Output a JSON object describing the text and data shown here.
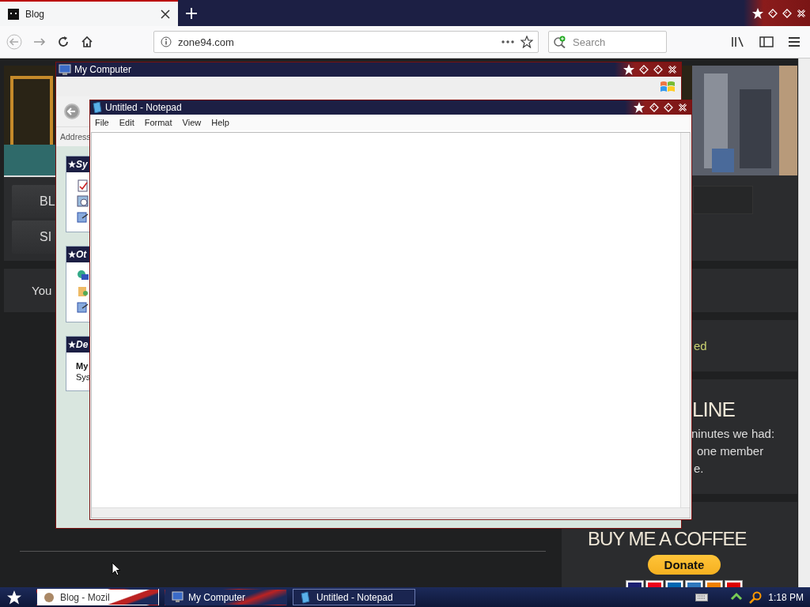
{
  "browser": {
    "tabs": [
      {
        "title": "Blog",
        "selected": true
      }
    ],
    "url": "zone94.com",
    "search": {
      "placeholder": "Search"
    }
  },
  "page": {
    "nav_items": [
      {
        "label": "BL"
      },
      {
        "label": "SI"
      }
    ],
    "notice": "You",
    "status_text": "ed",
    "online": {
      "heading": "LINE",
      "lines": [
        "ninutes we had:",
        "one member",
        "e."
      ]
    },
    "coffee": {
      "heading": "BUY ME A COFFEE",
      "button": "Donate"
    }
  },
  "my_computer": {
    "title": "My Computer",
    "address_label": "Address",
    "task_panels": [
      {
        "kind": "links",
        "title": "Sy"
      },
      {
        "kind": "links",
        "title": "Ot"
      },
      {
        "kind": "details",
        "title": "De",
        "lines": [
          "My",
          "Sys"
        ]
      }
    ]
  },
  "notepad": {
    "title": "Untitled - Notepad",
    "menu": [
      "File",
      "Edit",
      "Format",
      "View",
      "Help"
    ]
  },
  "taskbar": {
    "tasks": [
      {
        "label": "Blog - Mozil",
        "kind": "flag",
        "selected": false
      },
      {
        "label": "My Computer",
        "kind": "stripe",
        "selected": false
      },
      {
        "label": "Untitled - Notepad",
        "kind": "plain",
        "selected": true
      }
    ],
    "clock": "1:18 PM"
  }
}
